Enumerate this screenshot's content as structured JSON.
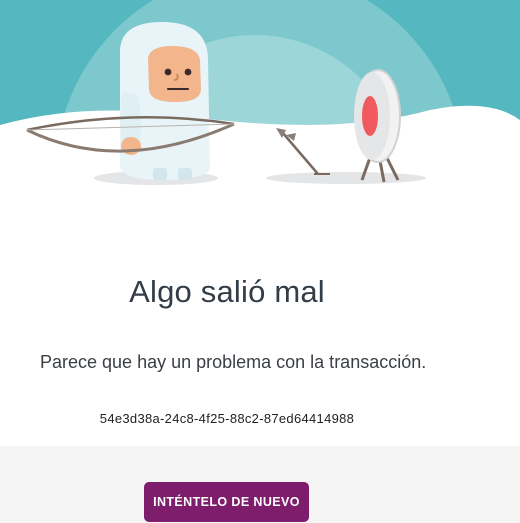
{
  "illustration": {
    "icons": [
      "yeti-archer-icon",
      "bow-icon",
      "arrow-icon",
      "archery-target-icon"
    ],
    "colors": {
      "sky_dark": "#55b7bf",
      "sky_light": "#93d2d6",
      "snow": "#ffffff",
      "target_center": "#f05a5f"
    }
  },
  "error": {
    "title": "Algo salió mal",
    "message": "Parece que hay un problema con la transacción.",
    "transaction_id": "54e3d38a-24c8-4f25-88c2-87ed64414988"
  },
  "actions": {
    "retry_label": "INTÉNTELO DE NUEVO"
  },
  "colors": {
    "button_bg": "#7d1d6b",
    "footer_bg": "#f5f5f6",
    "title_text": "#333d47"
  }
}
